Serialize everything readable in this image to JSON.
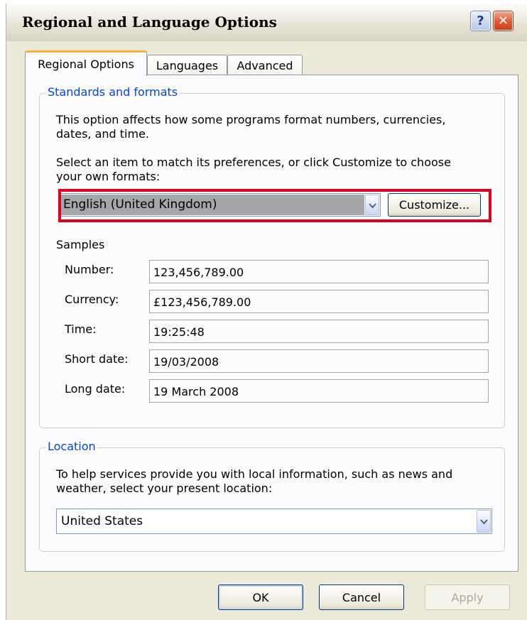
{
  "window": {
    "title": "Regional and Language Options",
    "help_glyph": "?",
    "close_glyph": "✕"
  },
  "tabs": [
    {
      "label": "Regional Options",
      "active": true
    },
    {
      "label": "Languages",
      "active": false
    },
    {
      "label": "Advanced",
      "active": false
    }
  ],
  "standards": {
    "legend": "Standards and formats",
    "description_line1": "This option affects how some programs format numbers, currencies,",
    "description_line2": "dates, and time.",
    "instruction_line1": "Select an item to match its preferences, or click Customize to choose",
    "instruction_line2": "your own formats:",
    "locale_value": "English (United Kingdom)",
    "customize_label": "Customize...",
    "samples_heading": "Samples",
    "samples": [
      {
        "label": "Number:",
        "value": "123,456,789.00"
      },
      {
        "label": "Currency:",
        "value": "£123,456,789.00"
      },
      {
        "label": "Time:",
        "value": "19:25:48"
      },
      {
        "label": "Short date:",
        "value": "19/03/2008"
      },
      {
        "label": "Long date:",
        "value": "19 March 2008"
      }
    ]
  },
  "location": {
    "legend": "Location",
    "description_line1": "To help services provide you with local information, such as news and",
    "description_line2": "weather, select your present location:",
    "value": "United States"
  },
  "footer": {
    "ok_label": "OK",
    "cancel_label": "Cancel",
    "apply_label": "Apply"
  },
  "colors": {
    "highlight": "#e0001b",
    "legend_text": "#0046d5",
    "active_tab_accent": "#f7b338"
  }
}
